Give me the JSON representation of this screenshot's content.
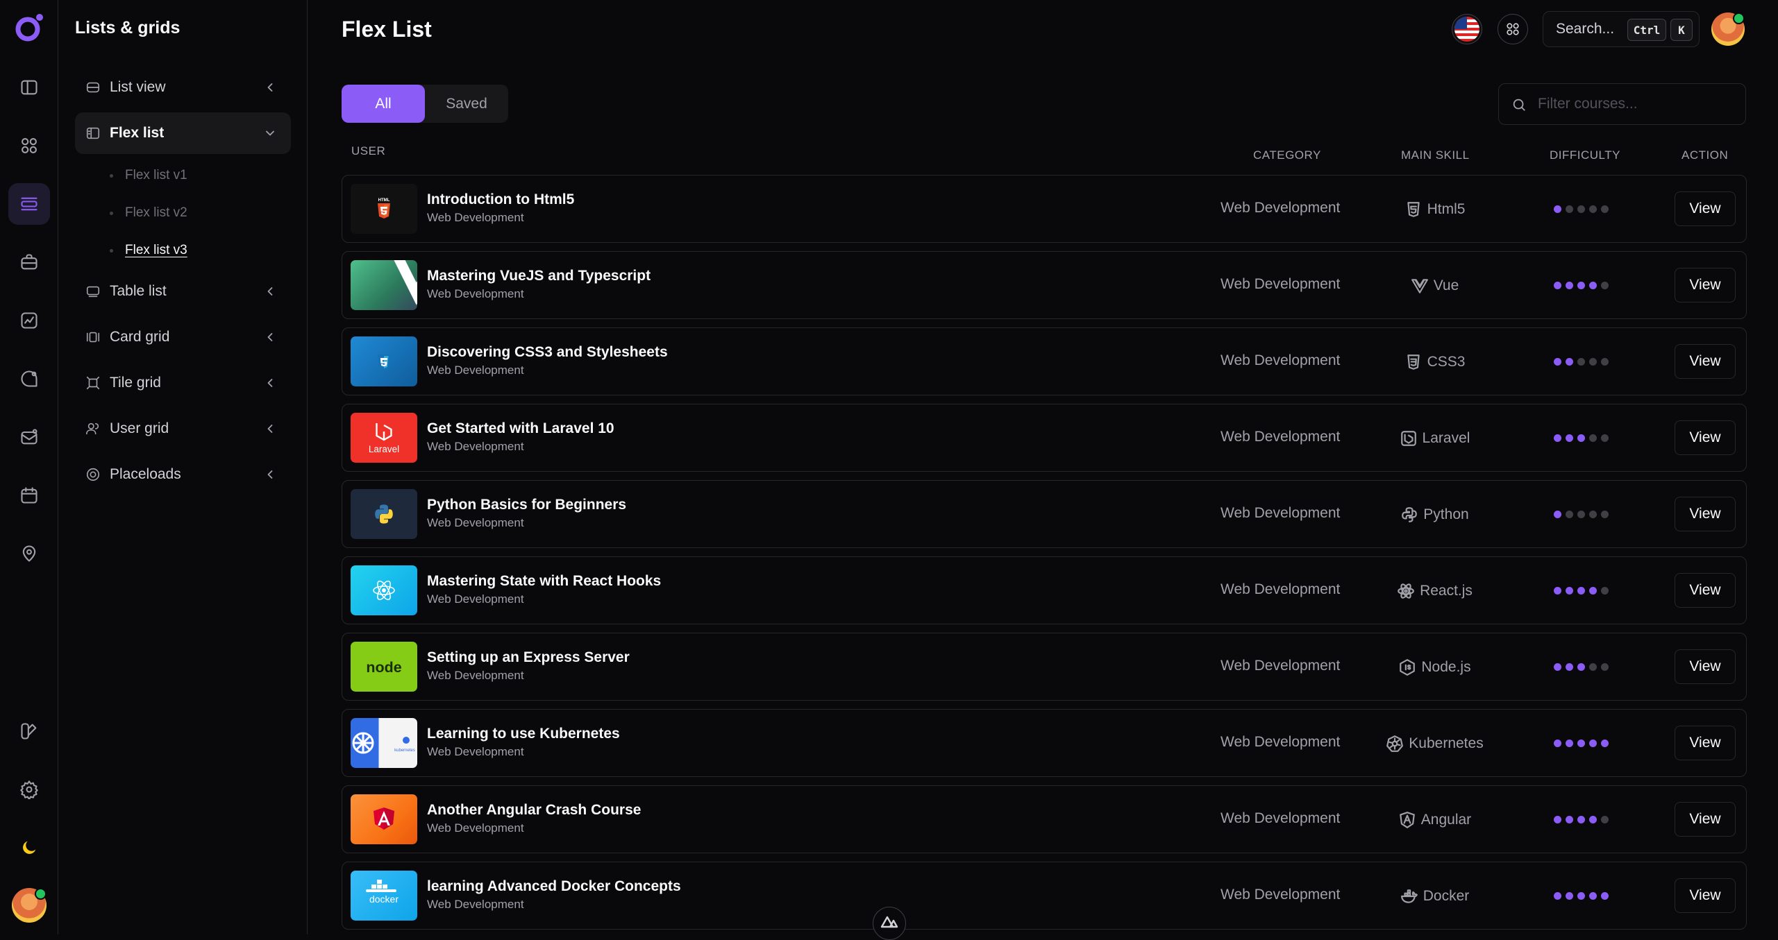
{
  "sidebar": {
    "title": "Lists & grids",
    "items": [
      {
        "label": "List view"
      },
      {
        "label": "Flex list"
      },
      {
        "label": "Table list"
      },
      {
        "label": "Card grid"
      },
      {
        "label": "Tile grid"
      },
      {
        "label": "User grid"
      },
      {
        "label": "Placeloads"
      }
    ],
    "subitems": [
      {
        "label": "Flex list v1"
      },
      {
        "label": "Flex list v2"
      },
      {
        "label": "Flex list v3"
      }
    ]
  },
  "header": {
    "title": "Flex List",
    "search_label": "Search...",
    "kbd_ctrl": "Ctrl",
    "kbd_k": "K"
  },
  "tabs": [
    {
      "label": "All"
    },
    {
      "label": "Saved"
    }
  ],
  "filter": {
    "placeholder": "Filter courses..."
  },
  "columns": {
    "user": "USER",
    "category": "CATEGORY",
    "main_skill": "MAIN SKILL",
    "difficulty": "DIFFICULTY",
    "action": "ACTION"
  },
  "colors": {
    "accent": "#8b5cf6",
    "background": "#09090b",
    "border": "#27272a"
  },
  "rows": [
    {
      "title": "Introduction to Html5",
      "subtitle": "Web Development",
      "category": "Web Development",
      "skill": "Html5",
      "skill_icon": "html5-icon",
      "difficulty": 1,
      "action": "View"
    },
    {
      "title": "Mastering VueJS and Typescript",
      "subtitle": "Web Development",
      "category": "Web Development",
      "skill": "Vue",
      "skill_icon": "vue-icon",
      "difficulty": 4,
      "action": "View"
    },
    {
      "title": "Discovering CSS3 and Stylesheets",
      "subtitle": "Web Development",
      "category": "Web Development",
      "skill": "CSS3",
      "skill_icon": "css3-icon",
      "difficulty": 2,
      "action": "View"
    },
    {
      "title": "Get Started with Laravel 10",
      "subtitle": "Web Development",
      "category": "Web Development",
      "skill": "Laravel",
      "skill_icon": "laravel-icon",
      "difficulty": 3,
      "action": "View"
    },
    {
      "title": "Python Basics for Beginners",
      "subtitle": "Web Development",
      "category": "Web Development",
      "skill": "Python",
      "skill_icon": "python-icon",
      "difficulty": 1,
      "action": "View"
    },
    {
      "title": "Mastering State with React Hooks",
      "subtitle": "Web Development",
      "category": "Web Development",
      "skill": "React.js",
      "skill_icon": "react-icon",
      "difficulty": 4,
      "action": "View"
    },
    {
      "title": "Setting up an Express Server",
      "subtitle": "Web Development",
      "category": "Web Development",
      "skill": "Node.js",
      "skill_icon": "nodejs-icon",
      "difficulty": 3,
      "action": "View"
    },
    {
      "title": "Learning to use Kubernetes",
      "subtitle": "Web Development",
      "category": "Web Development",
      "skill": "Kubernetes",
      "skill_icon": "kubernetes-icon",
      "difficulty": 5,
      "action": "View"
    },
    {
      "title": "Another Angular Crash Course",
      "subtitle": "Web Development",
      "category": "Web Development",
      "skill": "Angular",
      "skill_icon": "angular-icon",
      "difficulty": 4,
      "action": "View"
    },
    {
      "title": "learning Advanced Docker Concepts",
      "subtitle": "Web Development",
      "category": "Web Development",
      "skill": "Docker",
      "skill_icon": "docker-icon",
      "difficulty": 5,
      "action": "View"
    }
  ],
  "thumb_text": {
    "html": "HTML",
    "laravel": "Laravel",
    "node": "node",
    "kubernetes": "kubernetes",
    "docker": "docker"
  }
}
